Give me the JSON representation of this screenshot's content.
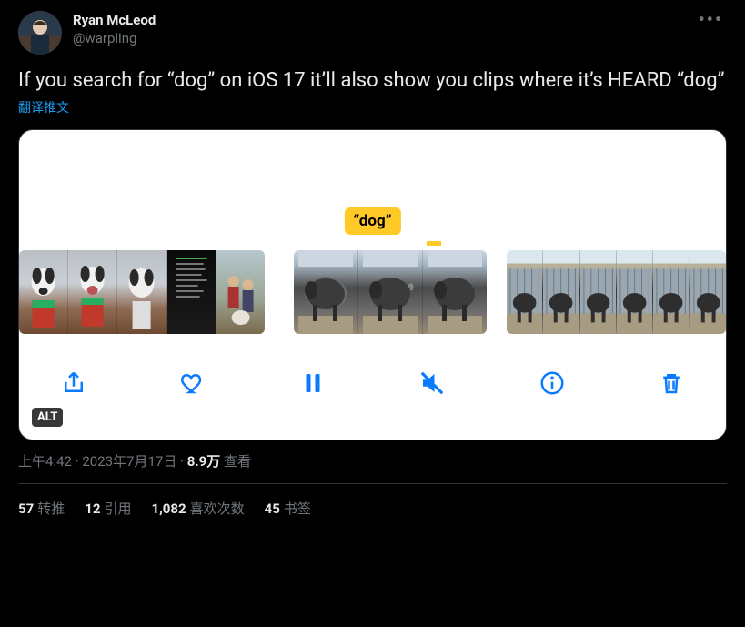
{
  "author": {
    "display_name": "Ryan McLeod",
    "handle": "@warpling"
  },
  "tweet_text": "If you search for “dog” on iOS 17 it’ll also show you clips where it’s HEARD “dog”",
  "translate_label": "翻译推文",
  "media": {
    "search_tag": "“dog”",
    "alt_badge": "ALT",
    "toolbar": {
      "share": "share",
      "like": "like",
      "pause": "pause",
      "mute": "mute",
      "info": "info",
      "trash": "trash"
    }
  },
  "meta": {
    "time": "上午4:42",
    "sep1": " · ",
    "date": "2023年7月17日",
    "sep2": " · ",
    "views_count": "8.9万",
    "views_label": " 查看"
  },
  "stats": {
    "retweets_count": "57",
    "retweets_label": "转推",
    "quotes_count": "12",
    "quotes_label": "引用",
    "likes_count": "1,082",
    "likes_label": "喜欢次数",
    "bookmarks_count": "45",
    "bookmarks_label": "书签"
  }
}
